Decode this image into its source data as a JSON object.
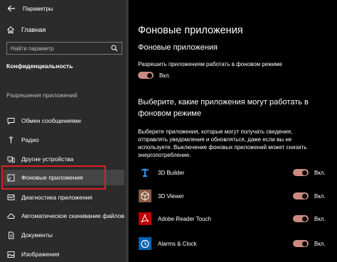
{
  "window": {
    "title": "Параметры"
  },
  "sidebar": {
    "home_label": "Главная",
    "search_placeholder": "Найти параметр",
    "section_title": "Конфиденциальность",
    "subsection_title": "Разрешения приложений",
    "items": [
      {
        "label": "Обмен сообщениями",
        "icon": "message-icon"
      },
      {
        "label": "Радио",
        "icon": "radio-icon"
      },
      {
        "label": "Другие устройства",
        "icon": "devices-icon"
      },
      {
        "label": "Фоновые приложения",
        "icon": "background-apps-icon",
        "active": true
      },
      {
        "label": "Диагностика приложения",
        "icon": "diagnostics-icon"
      },
      {
        "label": "Автоматическое скачивание файлов",
        "icon": "cloud-icon"
      },
      {
        "label": "Документы",
        "icon": "document-icon"
      },
      {
        "label": "Изображения",
        "icon": "image-icon"
      }
    ]
  },
  "main": {
    "title": "Фоновые приложения",
    "subheading": "Фоновые приложения",
    "allow_text": "Разрешить приложениям работать в фоновом режиме",
    "master_toggle": {
      "state": "on",
      "label": "Вкл."
    },
    "question": "Выберите, какие приложения могут работать в фоновом режиме",
    "description": "Выберите приложения, которые могут получать сведения, отправлять уведомления и обновляться, даже если вы не используете. Выключение фоновых приложений может снизить энергопотребление.",
    "apps": [
      {
        "name": "3D Builder",
        "toggle_label": "Вкл.",
        "state": "on",
        "icon_color": "#0078d7",
        "icon": "3d-builder-icon"
      },
      {
        "name": "3D Viewer",
        "toggle_label": "Вкл.",
        "state": "on",
        "icon_color": "#8a5a44",
        "icon": "3d-viewer-icon"
      },
      {
        "name": "Adobe Reader Touch",
        "toggle_label": "Вкл.",
        "state": "on",
        "icon_color": "#c00000",
        "icon": "adobe-reader-icon"
      },
      {
        "name": "Alarms & Clock",
        "toggle_label": "Вкл.",
        "state": "on",
        "icon_color": "#0063b1",
        "icon": "alarm-clock-icon"
      }
    ]
  },
  "colors": {
    "sidebar_bg": "#2b2b2b",
    "main_bg": "#000000",
    "toggle_on": "#c98b80",
    "highlight": "#e02020"
  }
}
